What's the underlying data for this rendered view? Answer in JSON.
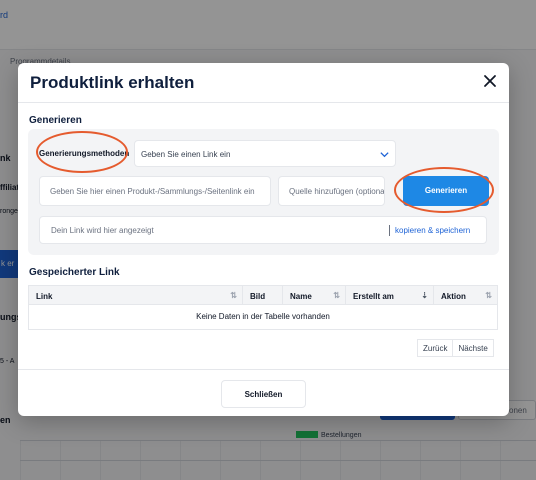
{
  "background": {
    "top_link": "rd",
    "tab_label": "Programmdetails",
    "left_fragments": [
      "nk",
      "ffiliat",
      "ronge",
      "ungs",
      "5 - A",
      "en"
    ],
    "left_button": "k er",
    "right_button_text": "onen",
    "legend_label": "Bestellungen",
    "legend_color": "#22c55e"
  },
  "modal": {
    "title": "Produktlink erhalten",
    "close_icon": "close-icon",
    "generate_section": {
      "label": "Generieren",
      "method_label": "Generierungsmethoden",
      "method_select_value": "Geben Sie einen Link ein",
      "link_input_placeholder": "Geben Sie hier einen Produkt-/Sammlungs-/Seitenlink ein",
      "source_input_placeholder": "Quelle hinzufügen (optional)",
      "generate_button": "Generieren",
      "output_placeholder": "Dein Link wird hier angezeigt",
      "copy_save_label": "kopieren & speichern"
    },
    "saved_section": {
      "label": "Gespeicherter Link",
      "columns": [
        "Link",
        "Bild",
        "Name",
        "Erstellt am",
        "Aktion"
      ],
      "empty_message": "Keine Daten in der Tabelle vorhanden",
      "pagination": {
        "prev": "Zurück",
        "next": "Nächste"
      }
    },
    "close_button": "Schließen"
  },
  "colors": {
    "primary": "#1e88e5",
    "title": "#0f1f3d",
    "annotation": "#e55b2e",
    "overlay": "rgba(0,0,0,0.42)"
  }
}
